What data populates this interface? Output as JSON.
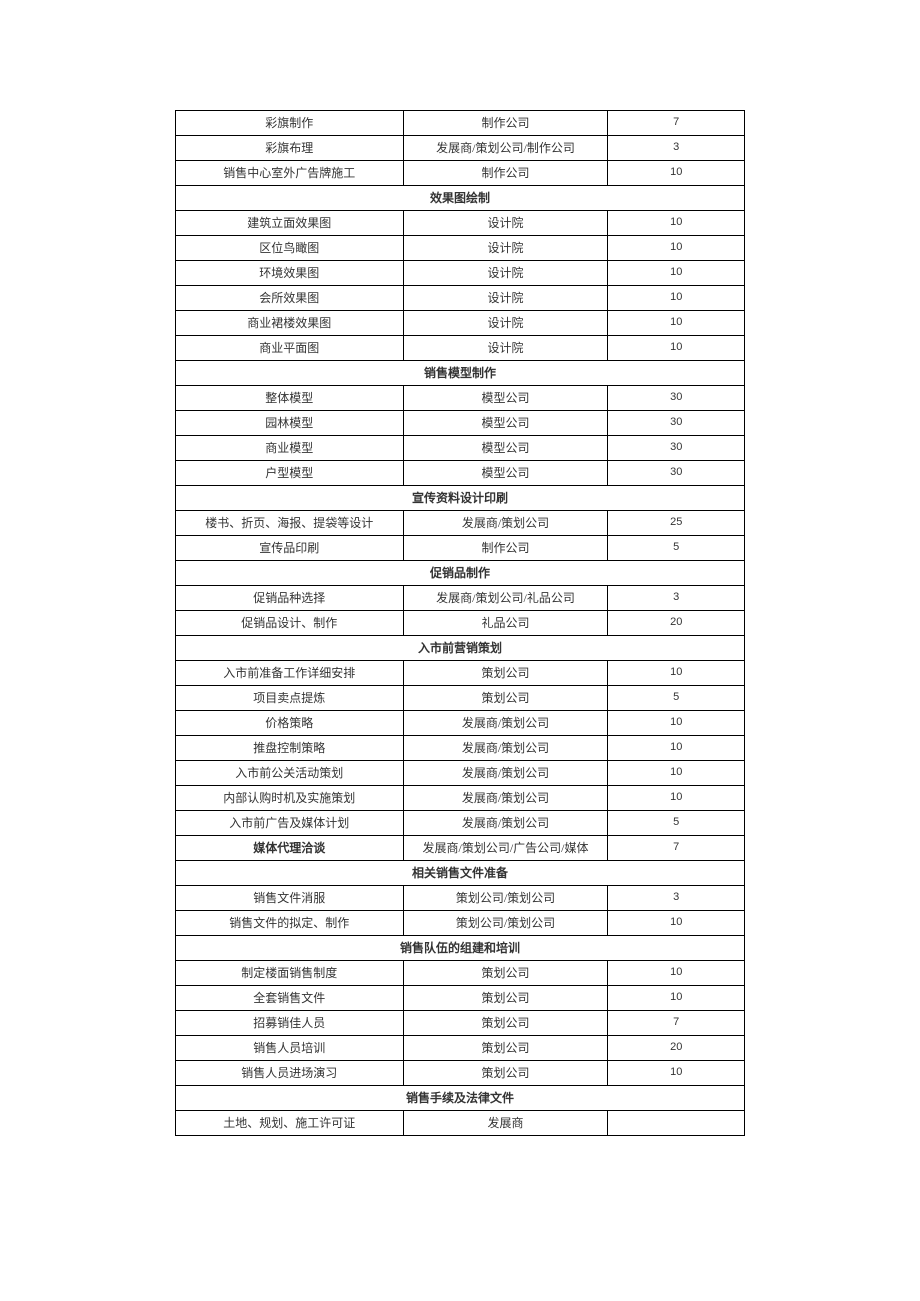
{
  "rows": [
    {
      "type": "row",
      "c1": "彩旗制作",
      "c2": "制作公司",
      "c3": "7"
    },
    {
      "type": "row",
      "c1": "彩旗布理",
      "c2": "发展商/策划公司/制作公司",
      "c3": "3"
    },
    {
      "type": "row",
      "c1": "销售中心室外广告牌施工",
      "c2": "制作公司",
      "c3": "10"
    },
    {
      "type": "header",
      "label": "效果图绘制"
    },
    {
      "type": "row",
      "c1": "建筑立面效果图",
      "c2": "设计院",
      "c3": "10"
    },
    {
      "type": "row",
      "c1": "区位鸟瞰图",
      "c2": "设计院",
      "c3": "10"
    },
    {
      "type": "row",
      "c1": "环境效果图",
      "c2": "设计院",
      "c3": "10"
    },
    {
      "type": "row",
      "c1": "会所效果图",
      "c2": "设计院",
      "c3": "10"
    },
    {
      "type": "row",
      "c1": "商业裙楼效果图",
      "c2": "设计院",
      "c3": "10"
    },
    {
      "type": "row",
      "c1": "商业平面图",
      "c2": "设计院",
      "c3": "10"
    },
    {
      "type": "header",
      "label": "销售模型制作"
    },
    {
      "type": "row",
      "c1": "整体模型",
      "c2": "模型公司",
      "c3": "30"
    },
    {
      "type": "row",
      "c1": "园林模型",
      "c2": "模型公司",
      "c3": "30"
    },
    {
      "type": "row",
      "c1": "商业模型",
      "c2": "模型公司",
      "c3": "30"
    },
    {
      "type": "row",
      "c1": "户型模型",
      "c2": "模型公司",
      "c3": "30"
    },
    {
      "type": "header",
      "label": "宣传资料设计印刷"
    },
    {
      "type": "row",
      "c1": "楼书、折页、海报、提袋等设计",
      "c2": "发展商/策划公司",
      "c3": "25"
    },
    {
      "type": "row",
      "c1": "宣传品印刷",
      "c2": "制作公司",
      "c3": "5"
    },
    {
      "type": "header",
      "label": "促销品制作"
    },
    {
      "type": "row",
      "c1": "促销品种选择",
      "c2": "发展商/策划公司/礼品公司",
      "c3": "3"
    },
    {
      "type": "row",
      "c1": "促销品设计、制作",
      "c2": "礼品公司",
      "c3": "20"
    },
    {
      "type": "header",
      "label": "入市前营销策划"
    },
    {
      "type": "row",
      "c1": "入市前准备工作详细安排",
      "c2": "策划公司",
      "c3": "10"
    },
    {
      "type": "row",
      "c1": "项目卖点提炼",
      "c2": "策划公司",
      "c3": "5"
    },
    {
      "type": "row",
      "c1": "价格策略",
      "c2": "发展商/策划公司",
      "c3": "10"
    },
    {
      "type": "row",
      "c1": "推盘控制策略",
      "c2": "发展商/策划公司",
      "c3": "10"
    },
    {
      "type": "row",
      "c1": "入市前公关活动策划",
      "c2": "发展商/策划公司",
      "c3": "10"
    },
    {
      "type": "row",
      "c1": "内部认购时机及实施策划",
      "c2": "发展商/策划公司",
      "c3": "10"
    },
    {
      "type": "row",
      "c1": "入市前广告及媒体计划",
      "c2": "发展商/策划公司",
      "c3": "5"
    },
    {
      "type": "row",
      "bold": true,
      "c1": "媒体代理洽谈",
      "c2": "发展商/策划公司/广告公司/媒体",
      "c3": "7"
    },
    {
      "type": "header",
      "label": "相关销售文件准备"
    },
    {
      "type": "row",
      "c1": "销售文件消服",
      "c2": "策划公司/策划公司",
      "c3": "3"
    },
    {
      "type": "row",
      "c1": "销售文件的拟定、制作",
      "c2": "策划公司/策划公司",
      "c3": "10"
    },
    {
      "type": "header",
      "label": "销售队伍的组建和培训"
    },
    {
      "type": "row",
      "c1": "制定楼面销售制度",
      "c2": "策划公司",
      "c3": "10"
    },
    {
      "type": "row",
      "c1": "全套销售文件",
      "c2": "策划公司",
      "c3": "10"
    },
    {
      "type": "row",
      "c1": "招募销佳人员",
      "c2": "策划公司",
      "c3": "7"
    },
    {
      "type": "row",
      "c1": "销售人员培训",
      "c2": "策划公司",
      "c3": "20"
    },
    {
      "type": "row",
      "c1": "销售人员进场演习",
      "c2": "策划公司",
      "c3": "10"
    },
    {
      "type": "header",
      "label": "销售手续及法律文件"
    },
    {
      "type": "row",
      "c1": "土地、规划、施工许可证",
      "c2": "发展商",
      "c3": ""
    }
  ]
}
